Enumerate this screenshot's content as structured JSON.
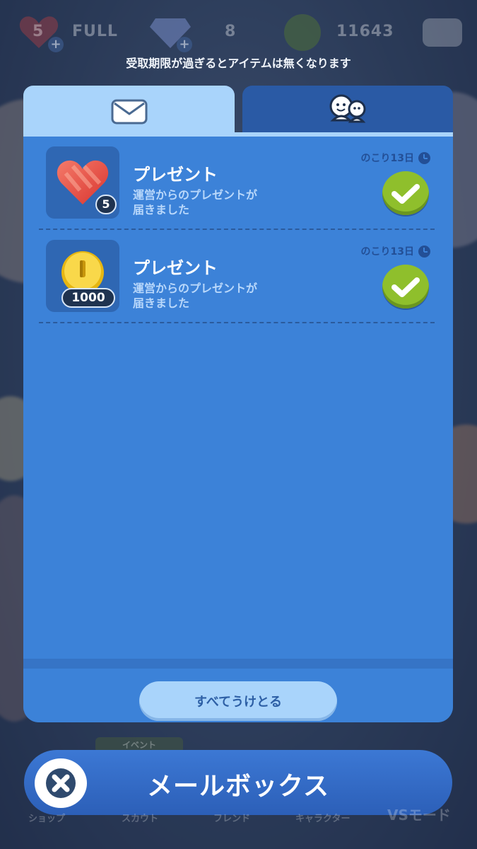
{
  "status_bar": {
    "hearts": {
      "value": "5",
      "status": "FULL",
      "icon": "heart-icon"
    },
    "gems": {
      "value": "8",
      "icon": "gem-icon"
    },
    "coins": {
      "value": "11643",
      "icon": "coin-icon"
    },
    "mail_icon": "mail-icon"
  },
  "notice": "受取期限が過ぎるとアイテムは無くなります",
  "tabs": [
    {
      "icon": "envelope-icon",
      "selected": true
    },
    {
      "icon": "friends-icon",
      "selected": false
    }
  ],
  "items": [
    {
      "title": "プレゼント",
      "subtitle_line1": "運営からのプレゼントが",
      "subtitle_line2": "届きました",
      "remaining": "のこり13日",
      "reward_icon": "heart-icon",
      "quantity": "5"
    },
    {
      "title": "プレゼント",
      "subtitle_line1": "運営からのプレゼントが",
      "subtitle_line2": "届きました",
      "remaining": "のこり13日",
      "reward_icon": "coin-icon",
      "quantity": "1000"
    }
  ],
  "receive_all_label": "すべてうけとる",
  "bottom_title": "メールボックス",
  "background_labels": {
    "event": "イベント",
    "nav": [
      "ショップ",
      "スカウト",
      "フレンド",
      "キャラクター",
      "VSモード"
    ]
  },
  "colors": {
    "panel": "#3c82d8",
    "tab_active": "#a9d4fb",
    "tab_inactive": "#2a5aa5",
    "check": "#8fbf2c",
    "bottom_bar": "#2c5fb8"
  }
}
